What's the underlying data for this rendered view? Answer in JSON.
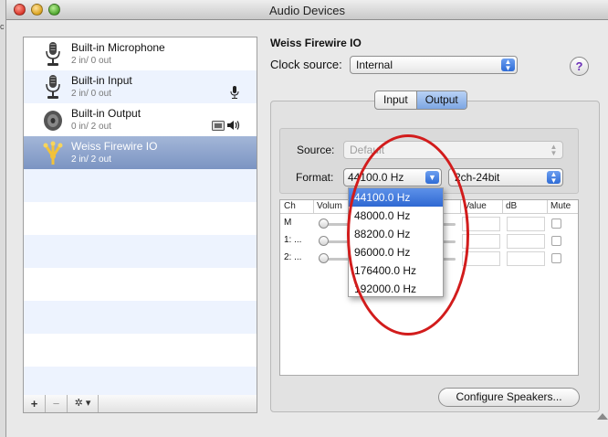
{
  "window": {
    "title": "Audio Devices"
  },
  "devices": [
    {
      "name": "Built-in Microphone",
      "io": "2 in/ 0 out",
      "icon": "microphone-icon"
    },
    {
      "name": "Built-in Input",
      "io": "2 in/ 0 out",
      "icon": "microphone-icon",
      "badge": "microphone-icon"
    },
    {
      "name": "Built-in Output",
      "io": "0 in/ 2 out",
      "icon": "speaker-icon",
      "badge": "speaker-icon"
    },
    {
      "name": "Weiss Firewire IO",
      "io": "2 in/ 2 out",
      "icon": "firewire-icon",
      "selected": true
    }
  ],
  "list_footer": {
    "add": "+",
    "remove": "−",
    "action": "✲ ▾"
  },
  "panel": {
    "device_title": "Weiss Firewire IO",
    "clock_label": "Clock source:",
    "clock_value": "Internal",
    "help": "?",
    "tabs": {
      "input": "Input",
      "output": "Output",
      "selected": "Output"
    },
    "source_label": "Source:",
    "source_value": "Default",
    "format_label": "Format:",
    "format_value": "44100.0 Hz",
    "channel_format": "2ch-24bit",
    "configure_button": "Configure Speakers..."
  },
  "channel_table": {
    "headers": {
      "ch": "Ch",
      "volume": "Volum",
      "value": "Value",
      "db": "dB",
      "mute": "Mute"
    },
    "rows": [
      {
        "label": "M"
      },
      {
        "label": "1: ..."
      },
      {
        "label": "2: ..."
      }
    ]
  },
  "format_menu": {
    "options": [
      "44100.0 Hz",
      "48000.0 Hz",
      "88200.0 Hz",
      "96000.0 Hz",
      "176400.0 Hz",
      "192000.0 Hz"
    ],
    "highlighted": "44100.0 Hz"
  },
  "colors": {
    "selection": "#7b94c2",
    "annotation_circle": "#d21c1c",
    "menu_highlight": "#2f68d2"
  },
  "outer_left": "c"
}
